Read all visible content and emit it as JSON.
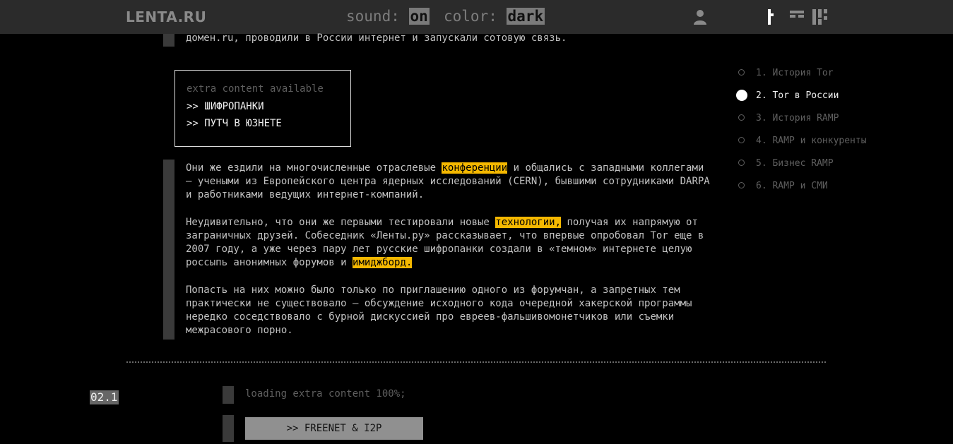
{
  "header": {
    "logo": "LENTA.RU",
    "sound_label": "sound:",
    "sound_value": "on",
    "color_label": "color:",
    "color_value": "dark",
    "icons": [
      "user-icon",
      "layout-single-icon",
      "layout-text-icon",
      "layout-grid-icon"
    ]
  },
  "article": {
    "top_line": "домен.ru, проводили в России интернет и запускали сотовую связь.",
    "extra": {
      "caption": "extra content available",
      "links": [
        ">> ШИФРОПАНКИ",
        ">> ПУТЧ В ЮЗНЕТЕ"
      ]
    },
    "p1": {
      "a": "Они же ездили на многочисленные отраслевые ",
      "hl": "конференции",
      "b": " и общались с западными коллегами — учеными из Европейского центра ядерных исследований (CERN), бывшими сотрудниками DARPA и работниками ведущих интернет-компаний."
    },
    "p2": {
      "a": "Неудивительно, что они же первыми тестировали новые ",
      "hl1": "технологии,",
      "b": " получая их напрямую от заграничных друзей. Собеседник «Ленты.ру» рассказывает, что впервые опробовал Tor еще в 2007 году, а уже через пару лет русские шифропанки создали в «темном» интернете целую россыпь анонимных форумов и ",
      "hl2": "имиджборд."
    },
    "p3": "Попасть на них можно было только по приглашению одного из форумчан, а запретных тем практически не существовало — обсуждение исходного кода очередной хакерской программы нередко соседствовало с бурной дискуссией про евреев-фальшивомонетчиков или съемки межрасового порно."
  },
  "toc": {
    "items": [
      {
        "label": "1. История Tor",
        "active": false
      },
      {
        "label": "2. Tor в России",
        "active": true
      },
      {
        "label": "3. История RAMP",
        "active": false
      },
      {
        "label": "4. RAMP и конкуренты",
        "active": false
      },
      {
        "label": "5. Бизнес RAMP",
        "active": false
      },
      {
        "label": "6. RAMP и СМИ",
        "active": false
      }
    ]
  },
  "section": {
    "number": "02.1",
    "loading": "loading extra content 100%;",
    "button": ">> FREENET & I2P"
  },
  "colors": {
    "highlight": "#f5b800",
    "topbar": "#2b2b2b",
    "background": "#000000"
  }
}
